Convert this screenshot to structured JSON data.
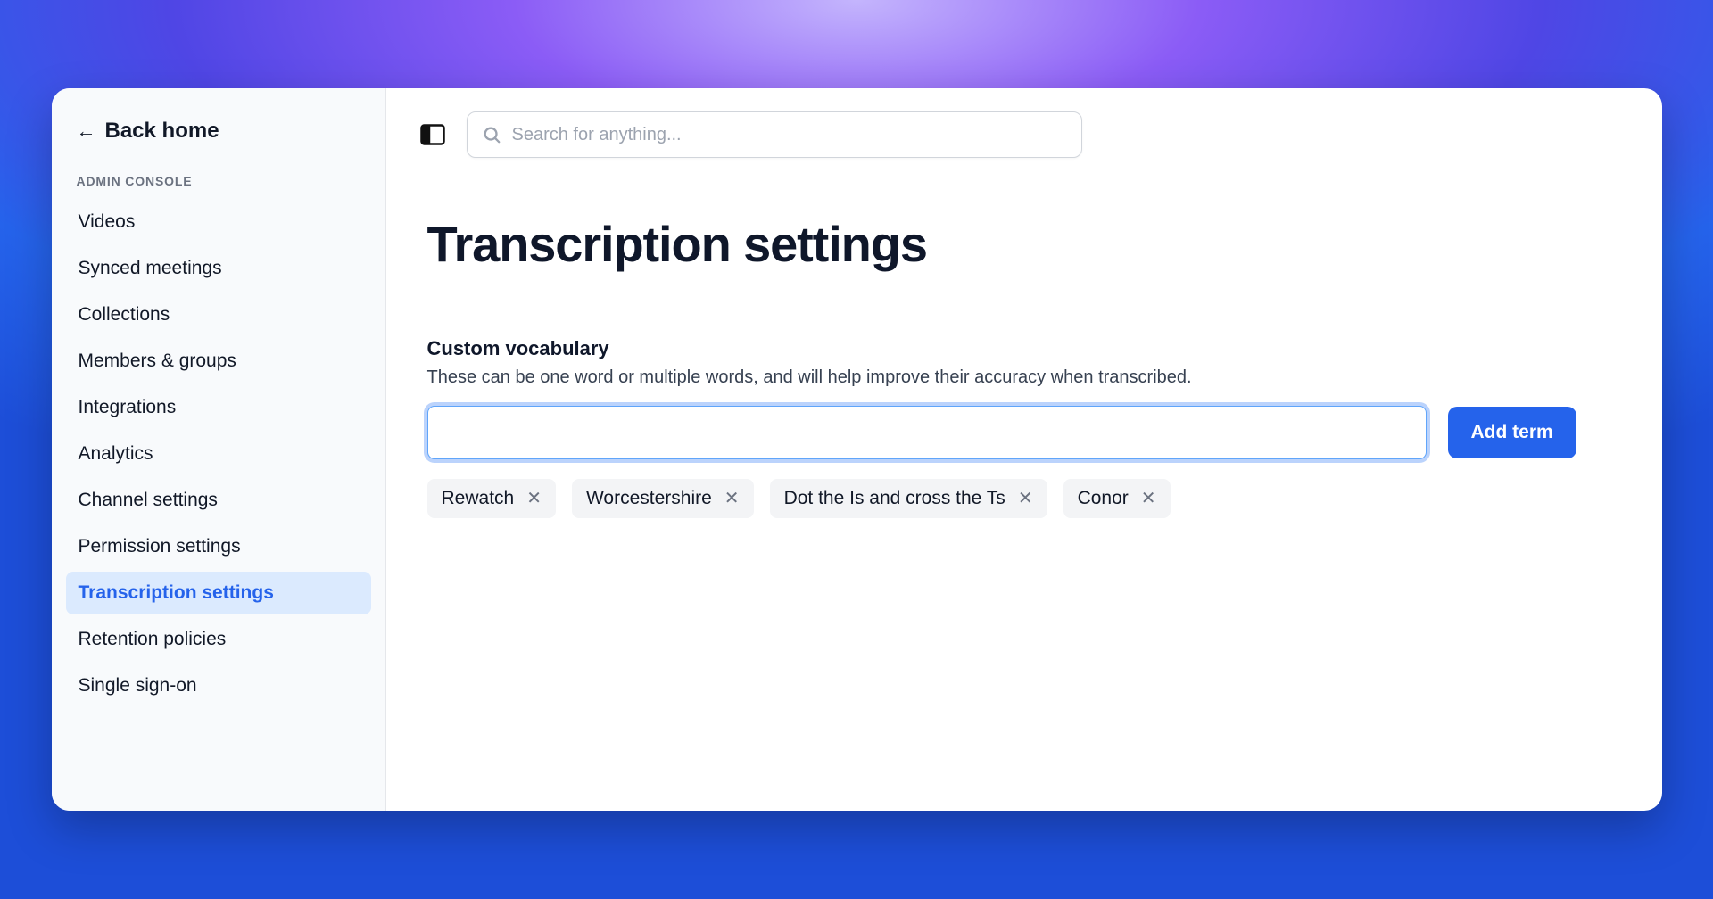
{
  "back_home_label": "Back home",
  "sidebar": {
    "section_header": "ADMIN CONSOLE",
    "items": [
      {
        "label": "Videos",
        "active": false
      },
      {
        "label": "Synced meetings",
        "active": false
      },
      {
        "label": "Collections",
        "active": false
      },
      {
        "label": "Members & groups",
        "active": false
      },
      {
        "label": "Integrations",
        "active": false
      },
      {
        "label": "Analytics",
        "active": false
      },
      {
        "label": "Channel settings",
        "active": false
      },
      {
        "label": "Permission settings",
        "active": false
      },
      {
        "label": "Transcription settings",
        "active": true
      },
      {
        "label": "Retention policies",
        "active": false
      },
      {
        "label": "Single sign-on",
        "active": false
      }
    ]
  },
  "search": {
    "placeholder": "Search for anything..."
  },
  "page_title": "Transcription settings",
  "vocab": {
    "title": "Custom vocabulary",
    "description": "These can be one word or multiple words, and will help improve their accuracy when transcribed.",
    "add_button_label": "Add term",
    "input_value": "",
    "terms": [
      "Rewatch",
      "Worcestershire",
      "Dot the Is and cross the Ts",
      "Conor"
    ]
  }
}
